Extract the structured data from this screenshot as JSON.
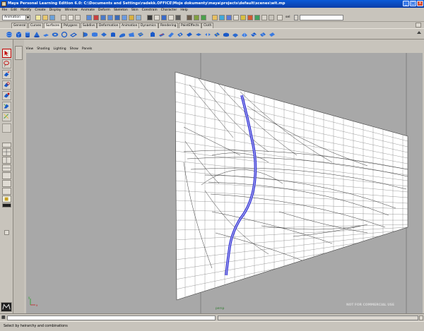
{
  "window": {
    "title": "Maya Personal Learning Edition 6.0: C:\\Documents and Settings\\radekk.OFFICE\\Moje dokumenty\\maya\\projects\\default\\scenes\\wit.mp",
    "controls": {
      "minimize": "_",
      "maximize": "□",
      "close": "×"
    }
  },
  "menubar": {
    "items": [
      "File",
      "Edit",
      "Modify",
      "Create",
      "Display",
      "Window",
      "Animate",
      "Deform",
      "Skeleton",
      "Skin",
      "Constrain",
      "Character",
      "Help"
    ]
  },
  "statusline": {
    "mode": "Animation",
    "sel_label": "sel"
  },
  "shelf": {
    "tabs": [
      "General",
      "Curves",
      "Surfaces",
      "Polygons",
      "Subdivs",
      "Deformation",
      "Animation",
      "Dynamics",
      "Rendering",
      "PaintEffects",
      "Cloth"
    ],
    "active_tab": "Surfaces"
  },
  "panel": {
    "menu": [
      "View",
      "Shading",
      "Lighting",
      "Show",
      "Panels"
    ],
    "camera_label": "persp",
    "watermark": "NOT FOR COMMERCIAL USE",
    "axis_x": "x",
    "axis_y": "y"
  },
  "helpline": {
    "text": "Select by heirarchy and combinations"
  },
  "colors": {
    "viewport_bg": "#a8a8a8",
    "ui_bg": "#c8c4bc",
    "title_blue": "#0a4cc8",
    "selected_curve": "#2a2ad8",
    "camera_label": "#2a7a2a"
  }
}
